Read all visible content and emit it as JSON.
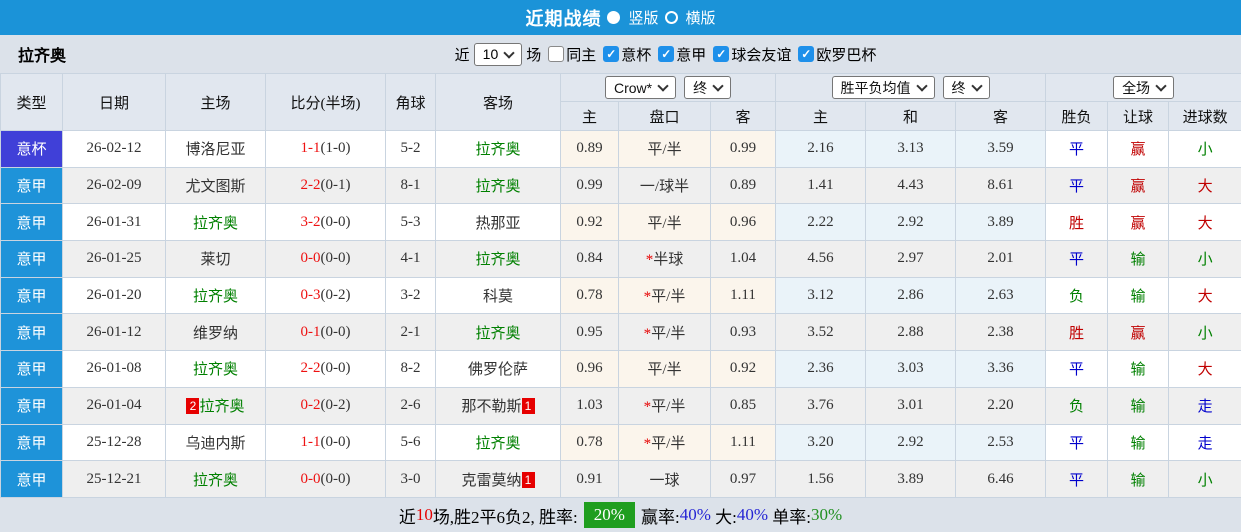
{
  "titlebar": {
    "title": "近期战绩",
    "radio_vertical_label": "竖版",
    "radio_horizontal_label": "横版",
    "selected_layout": "竖版"
  },
  "filterbar": {
    "team": "拉齐奥",
    "recent_label": "近",
    "count_value": "10",
    "matches_label": "场",
    "checkboxes": [
      {
        "label": "同主",
        "checked": false
      },
      {
        "label": "意杯",
        "checked": true
      },
      {
        "label": "意甲",
        "checked": true
      },
      {
        "label": "球会友谊",
        "checked": true
      },
      {
        "label": "欧罗巴杯",
        "checked": true
      }
    ]
  },
  "table": {
    "headers": {
      "type": "类型",
      "date": "日期",
      "home": "主场",
      "score": "比分(半场)",
      "corner": "角球",
      "away": "客场"
    },
    "selects": {
      "crow": "Crow*",
      "crow_final": "终",
      "avg": "胜平负均值",
      "avg_final": "终",
      "scope": "全场"
    },
    "sub_headers": {
      "crow_home": "主",
      "handicap": "盘口",
      "crow_away": "客",
      "avg_home": "主",
      "avg_draw": "和",
      "avg_away": "客",
      "result": "胜负",
      "handicap_result": "让球",
      "goals": "进球数"
    },
    "rows": [
      {
        "type": "意杯",
        "date": "26-02-12",
        "home": "博洛尼亚",
        "home_self": false,
        "home_rank": "",
        "score_ft": "1-1",
        "score_ht": "(1-0)",
        "corner": "5-2",
        "away": "拉齐奥",
        "away_self": true,
        "away_rank": "",
        "crow_home": "0.89",
        "star": "",
        "handicap": "平/半",
        "crow_away": "0.99",
        "avg_home": "2.16",
        "avg_draw": "3.13",
        "avg_away": "3.59",
        "result": "平",
        "handicap_result": "赢",
        "goals": "小"
      },
      {
        "type": "意甲",
        "date": "26-02-09",
        "home": "尤文图斯",
        "home_self": false,
        "home_rank": "",
        "score_ft": "2-2",
        "score_ht": "(0-1)",
        "corner": "8-1",
        "away": "拉齐奥",
        "away_self": true,
        "away_rank": "",
        "crow_home": "0.99",
        "star": "",
        "handicap": "一/球半",
        "crow_away": "0.89",
        "avg_home": "1.41",
        "avg_draw": "4.43",
        "avg_away": "8.61",
        "result": "平",
        "handicap_result": "赢",
        "goals": "大"
      },
      {
        "type": "意甲",
        "date": "26-01-31",
        "home": "拉齐奥",
        "home_self": true,
        "home_rank": "",
        "score_ft": "3-2",
        "score_ht": "(0-0)",
        "corner": "5-3",
        "away": "热那亚",
        "away_self": false,
        "away_rank": "",
        "crow_home": "0.92",
        "star": "",
        "handicap": "平/半",
        "crow_away": "0.96",
        "avg_home": "2.22",
        "avg_draw": "2.92",
        "avg_away": "3.89",
        "result": "胜",
        "handicap_result": "赢",
        "goals": "大"
      },
      {
        "type": "意甲",
        "date": "26-01-25",
        "home": "莱切",
        "home_self": false,
        "home_rank": "",
        "score_ft": "0-0",
        "score_ht": "(0-0)",
        "corner": "4-1",
        "away": "拉齐奥",
        "away_self": true,
        "away_rank": "",
        "crow_home": "0.84",
        "star": "*",
        "handicap": "半球",
        "crow_away": "1.04",
        "avg_home": "4.56",
        "avg_draw": "2.97",
        "avg_away": "2.01",
        "result": "平",
        "handicap_result": "输",
        "goals": "小"
      },
      {
        "type": "意甲",
        "date": "26-01-20",
        "home": "拉齐奥",
        "home_self": true,
        "home_rank": "",
        "score_ft": "0-3",
        "score_ht": "(0-2)",
        "corner": "3-2",
        "away": "科莫",
        "away_self": false,
        "away_rank": "",
        "crow_home": "0.78",
        "star": "*",
        "handicap": "平/半",
        "crow_away": "1.11",
        "avg_home": "3.12",
        "avg_draw": "2.86",
        "avg_away": "2.63",
        "result": "负",
        "handicap_result": "输",
        "goals": "大"
      },
      {
        "type": "意甲",
        "date": "26-01-12",
        "home": "维罗纳",
        "home_self": false,
        "home_rank": "",
        "score_ft": "0-1",
        "score_ht": "(0-0)",
        "corner": "2-1",
        "away": "拉齐奥",
        "away_self": true,
        "away_rank": "",
        "crow_home": "0.95",
        "star": "*",
        "handicap": "平/半",
        "crow_away": "0.93",
        "avg_home": "3.52",
        "avg_draw": "2.88",
        "avg_away": "2.38",
        "result": "胜",
        "handicap_result": "赢",
        "goals": "小"
      },
      {
        "type": "意甲",
        "date": "26-01-08",
        "home": "拉齐奥",
        "home_self": true,
        "home_rank": "",
        "score_ft": "2-2",
        "score_ht": "(0-0)",
        "corner": "8-2",
        "away": "佛罗伦萨",
        "away_self": false,
        "away_rank": "",
        "crow_home": "0.96",
        "star": "",
        "handicap": "平/半",
        "crow_away": "0.92",
        "avg_home": "2.36",
        "avg_draw": "3.03",
        "avg_away": "3.36",
        "result": "平",
        "handicap_result": "输",
        "goals": "大"
      },
      {
        "type": "意甲",
        "date": "26-01-04",
        "home": "拉齐奥",
        "home_self": true,
        "home_rank": "2",
        "score_ft": "0-2",
        "score_ht": "(0-2)",
        "corner": "2-6",
        "away": "那不勒斯",
        "away_self": false,
        "away_rank": "1",
        "crow_home": "1.03",
        "star": "*",
        "handicap": "平/半",
        "crow_away": "0.85",
        "avg_home": "3.76",
        "avg_draw": "3.01",
        "avg_away": "2.20",
        "result": "负",
        "handicap_result": "输",
        "goals": "走"
      },
      {
        "type": "意甲",
        "date": "25-12-28",
        "home": "乌迪内斯",
        "home_self": false,
        "home_rank": "",
        "score_ft": "1-1",
        "score_ht": "(0-0)",
        "corner": "5-6",
        "away": "拉齐奥",
        "away_self": true,
        "away_rank": "",
        "crow_home": "0.78",
        "star": "*",
        "handicap": "平/半",
        "crow_away": "1.11",
        "avg_home": "3.20",
        "avg_draw": "2.92",
        "avg_away": "2.53",
        "result": "平",
        "handicap_result": "输",
        "goals": "走"
      },
      {
        "type": "意甲",
        "date": "25-12-21",
        "home": "拉齐奥",
        "home_self": true,
        "home_rank": "",
        "score_ft": "0-0",
        "score_ht": "(0-0)",
        "corner": "3-0",
        "away": "克雷莫纳",
        "away_self": false,
        "away_rank": "1",
        "crow_home": "0.91",
        "star": "",
        "handicap": "一球",
        "crow_away": "0.97",
        "avg_home": "1.56",
        "avg_draw": "3.89",
        "avg_away": "6.46",
        "result": "平",
        "handicap_result": "输",
        "goals": "小"
      }
    ]
  },
  "summary": {
    "segments": [
      {
        "text": "近",
        "style": "plain"
      },
      {
        "text": "10",
        "style": "red"
      },
      {
        "text": "场,胜2平6负2, 胜率:",
        "style": "plain"
      },
      {
        "text": "20%",
        "style": "badge"
      },
      {
        "text": "赢率:",
        "style": "plain"
      },
      {
        "text": "40%",
        "style": "blue"
      },
      {
        "text": " 大:",
        "style": "plain"
      },
      {
        "text": "40%",
        "style": "blue"
      },
      {
        "text": " 单率:",
        "style": "plain"
      },
      {
        "text": "30%",
        "style": "green"
      }
    ]
  },
  "colors": {
    "accent_blue": "#1b93d8",
    "cup_badge": "#4040d8",
    "league_badge": "#1e93d9",
    "self_team_green": "#008000",
    "score_red": "#ee1111",
    "result_red": "#c00000",
    "result_blue": "#0000cc",
    "crow_col_bg": "#fbf5ec",
    "avg_col_bg": "#eaf3f9",
    "winrate_badge_green": "#1f9e1f"
  }
}
